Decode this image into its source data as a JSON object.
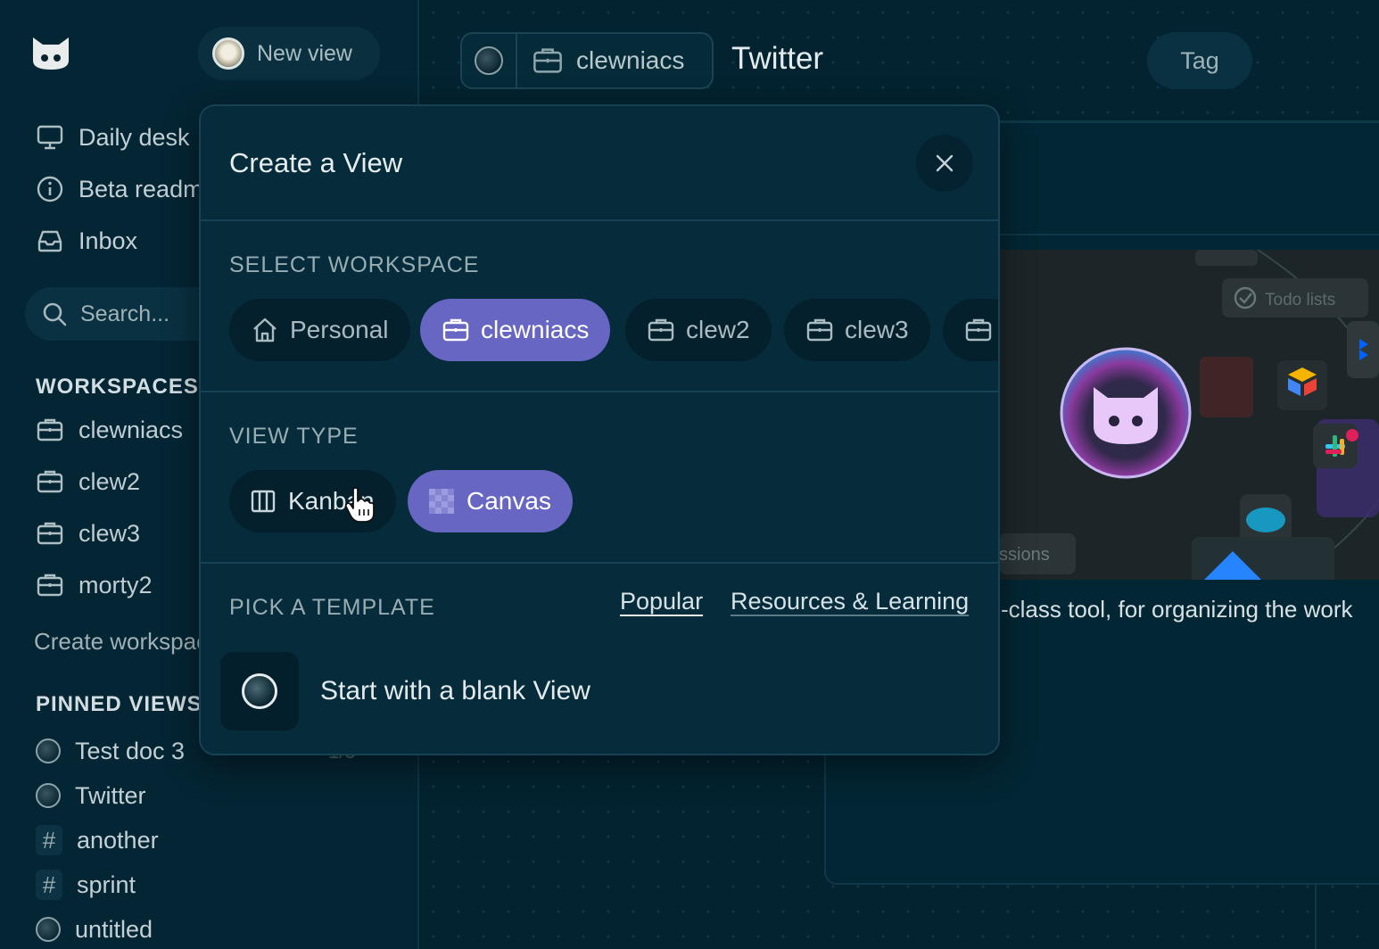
{
  "app": {
    "logo_icon": "cat-logo-icon"
  },
  "sidebar": {
    "new_view_label": "New view",
    "nav": [
      {
        "label": "Daily desk",
        "icon": "monitor-icon"
      },
      {
        "label": "Beta readme",
        "icon": "info-icon"
      },
      {
        "label": "Inbox",
        "icon": "inbox-icon"
      }
    ],
    "search_placeholder": "Search...",
    "workspaces_heading": "WORKSPACES",
    "workspaces": [
      "clewniacs",
      "clew2",
      "clew3",
      "morty2"
    ],
    "create_workspace_label": "Create workspace",
    "pinned_heading": "PINNED VIEWS",
    "pinned": [
      {
        "label": "Test doc 3",
        "kind": "view"
      },
      {
        "label": "Twitter",
        "kind": "view"
      },
      {
        "label": "another",
        "kind": "tag"
      },
      {
        "label": "sprint",
        "kind": "tag"
      },
      {
        "label": "untitled",
        "kind": "view"
      }
    ]
  },
  "header": {
    "workspace": "clewniacs",
    "title": "Twitter",
    "tag_label": "Tag"
  },
  "background_card": {
    "preview_labels": {
      "todo": "Todo lists",
      "sessions": "ssions"
    },
    "description": "-class tool, for organizing the work"
  },
  "modal": {
    "title": "Create a View",
    "select_workspace_label": "SELECT WORKSPACE",
    "workspaces": [
      {
        "label": "Personal",
        "icon": "home-icon",
        "active": false
      },
      {
        "label": "clewniacs",
        "icon": "briefcase-icon",
        "active": true
      },
      {
        "label": "clew2",
        "icon": "briefcase-icon",
        "active": false
      },
      {
        "label": "clew3",
        "icon": "briefcase-icon",
        "active": false
      },
      {
        "label": "",
        "icon": "briefcase-icon",
        "active": false
      }
    ],
    "view_type_label": "VIEW TYPE",
    "view_types": [
      {
        "label": "Kanban",
        "icon": "columns-icon",
        "active": false
      },
      {
        "label": "Canvas",
        "icon": "checker-icon",
        "active": true
      }
    ],
    "template_label": "PICK A TEMPLATE",
    "template_tabs": [
      {
        "label": "Popular",
        "active": true
      },
      {
        "label": "Resources & Learning",
        "active": false
      }
    ],
    "blank_view_label": "Start with a blank View"
  },
  "colors": {
    "background": "#032330",
    "accent": "#6766c3",
    "modal": "#062c3c"
  }
}
